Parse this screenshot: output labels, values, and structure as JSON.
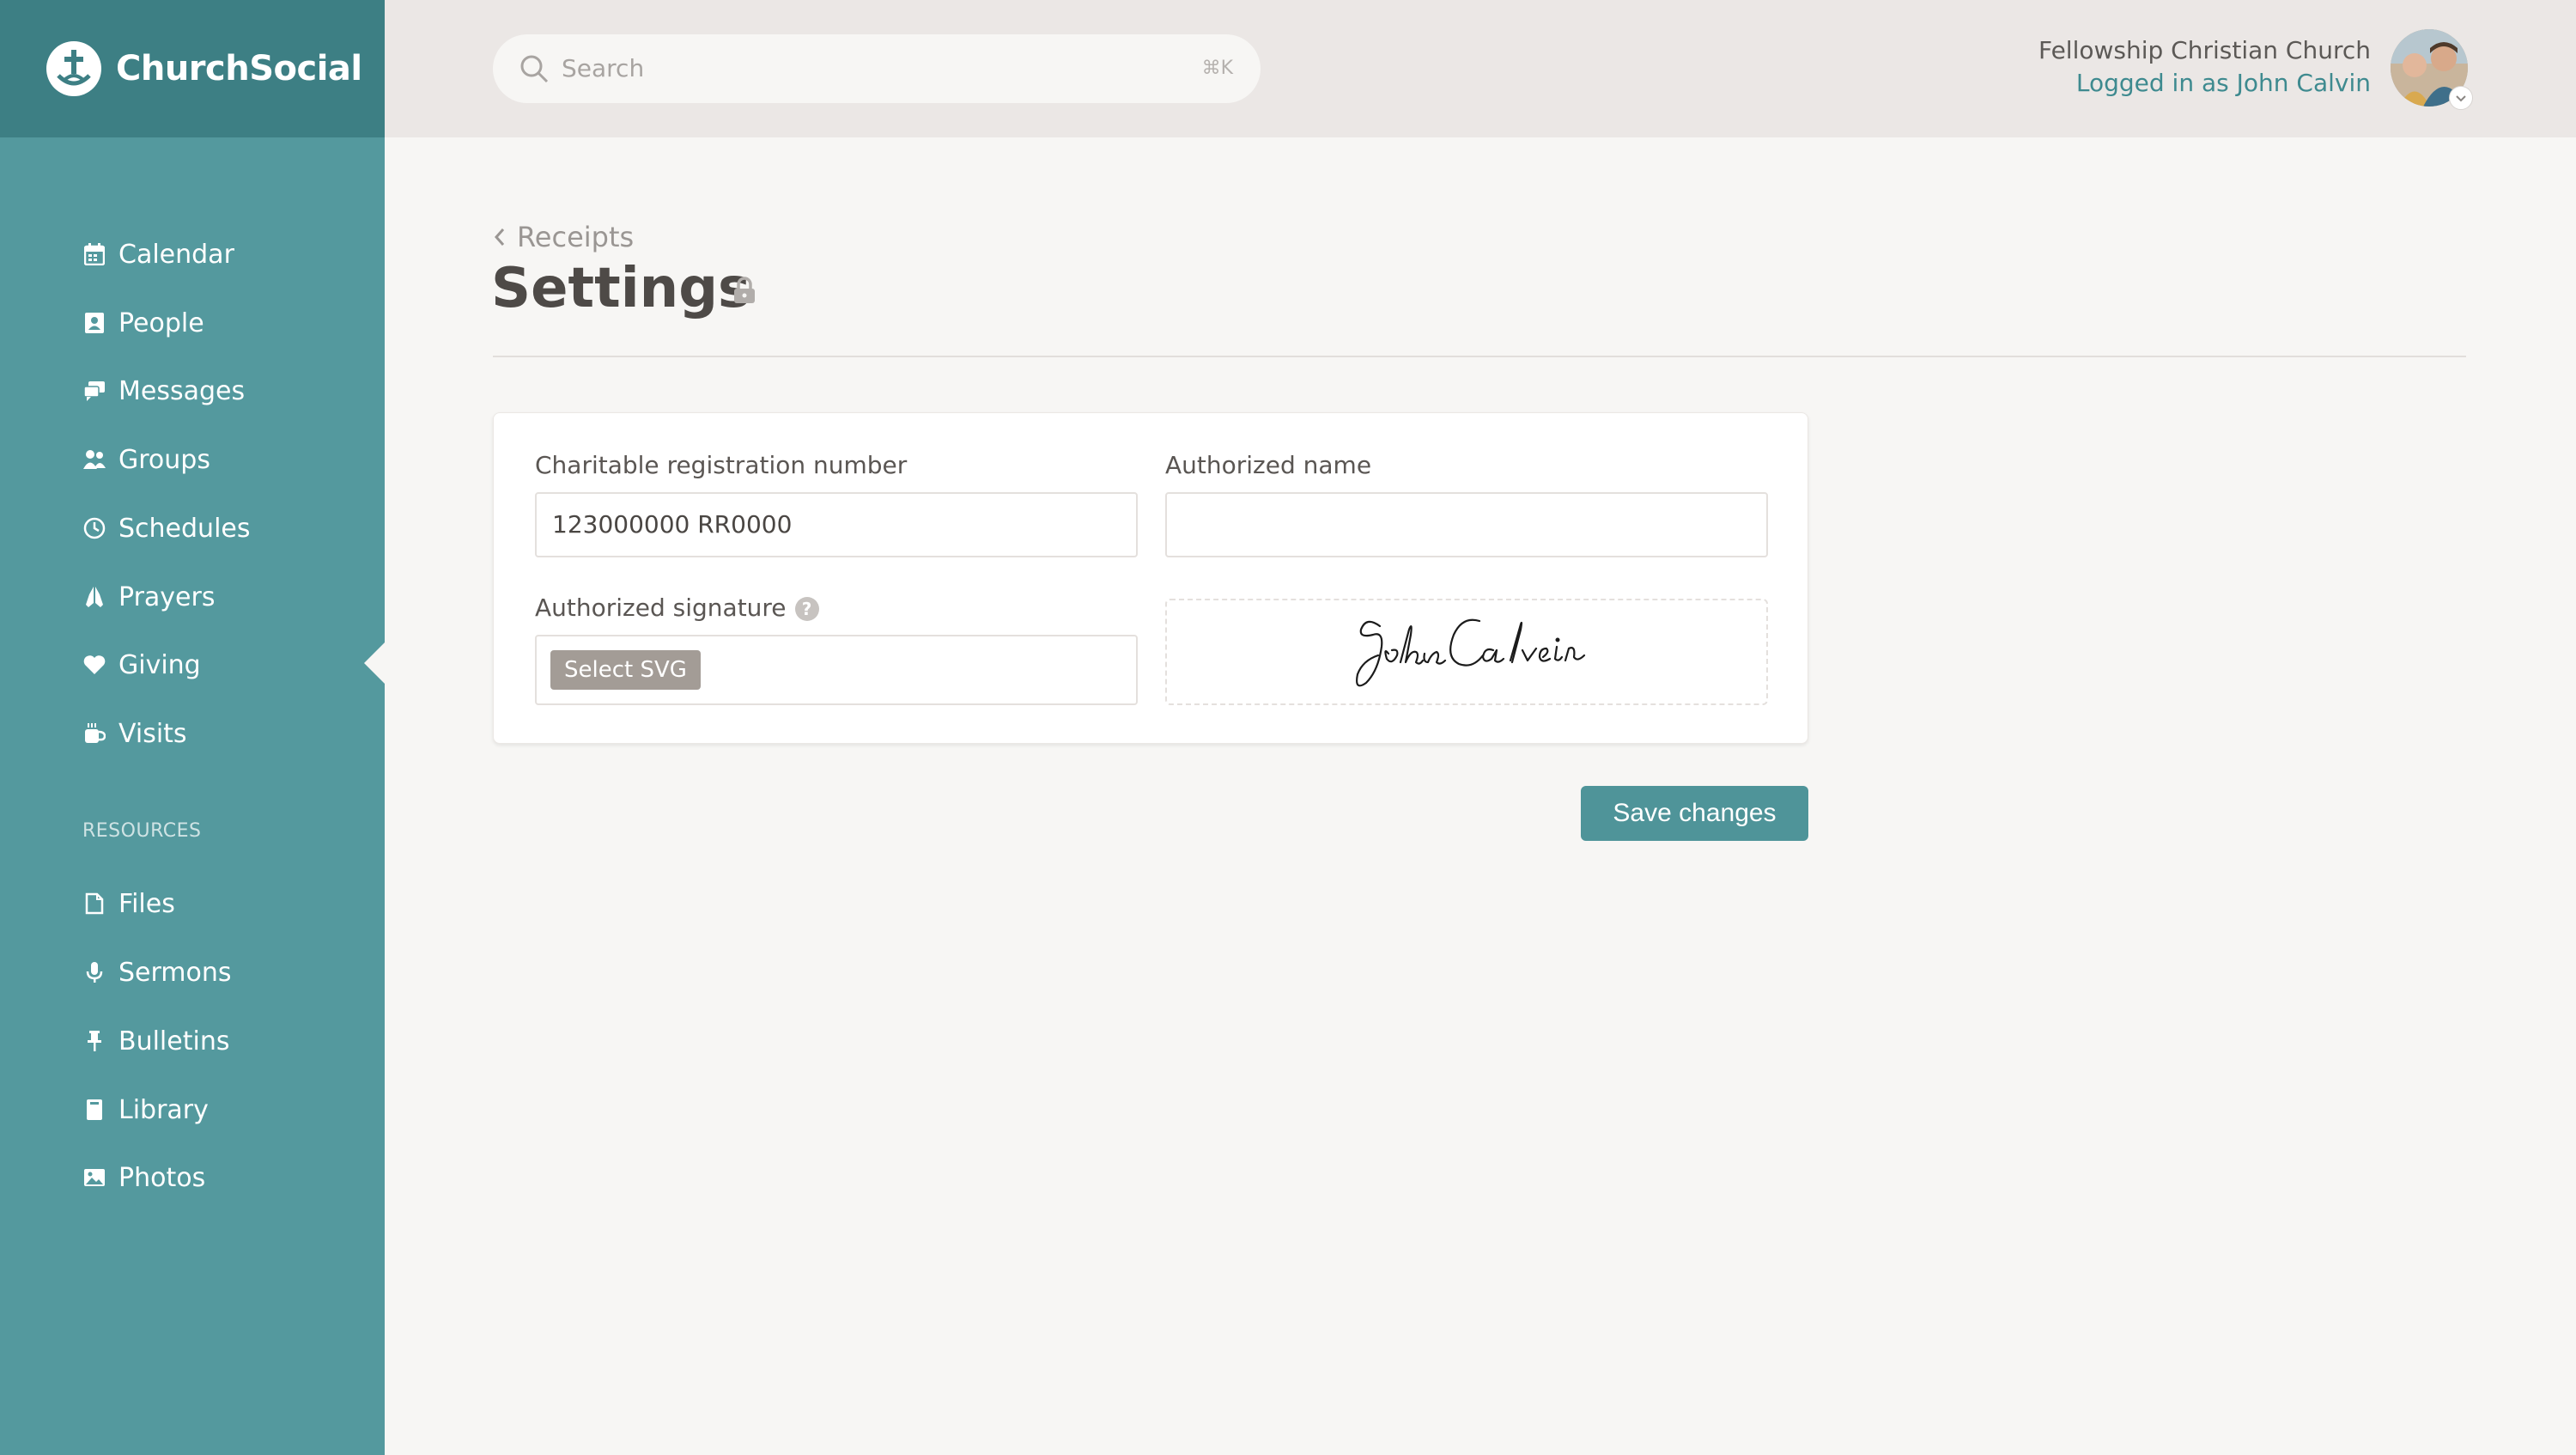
{
  "app": {
    "name": "ChurchSocial"
  },
  "search": {
    "placeholder": "Search",
    "shortcut": "⌘K"
  },
  "user": {
    "organization": "Fellowship Christian Church",
    "logged_in_label": "Logged in as John Calvin"
  },
  "sidebar": {
    "items": [
      {
        "label": "Calendar",
        "icon": "calendar-icon"
      },
      {
        "label": "People",
        "icon": "contact-card-icon"
      },
      {
        "label": "Messages",
        "icon": "chat-bubbles-icon"
      },
      {
        "label": "Groups",
        "icon": "users-icon"
      },
      {
        "label": "Schedules",
        "icon": "clock-icon"
      },
      {
        "label": "Prayers",
        "icon": "praying-hands-icon"
      },
      {
        "label": "Giving",
        "icon": "heart-icon",
        "active": true
      },
      {
        "label": "Visits",
        "icon": "coffee-cup-icon"
      }
    ],
    "resources_heading": "RESOURCES",
    "resources": [
      {
        "label": "Files",
        "icon": "file-icon"
      },
      {
        "label": "Sermons",
        "icon": "microphone-icon"
      },
      {
        "label": "Bulletins",
        "icon": "pushpin-icon"
      },
      {
        "label": "Library",
        "icon": "book-icon"
      },
      {
        "label": "Photos",
        "icon": "image-icon"
      }
    ]
  },
  "page": {
    "breadcrumb": "Receipts",
    "title": "Settings"
  },
  "form": {
    "registration_label": "Charitable registration number",
    "registration_value": "123000000 RR0000",
    "authorized_name_label": "Authorized name",
    "authorized_name_value": "",
    "signature_label": "Authorized signature",
    "help_glyph": "?",
    "select_svg_label": "Select SVG",
    "save_label": "Save changes"
  },
  "colors": {
    "sidebar": "#54999e",
    "logo_bar": "#3d7f84",
    "accent": "#4f9499",
    "link": "#3e8a8f"
  }
}
